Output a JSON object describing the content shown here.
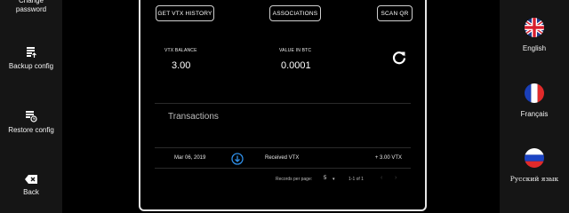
{
  "left_nav": {
    "change_password": "Change password",
    "backup_config": "Backup config",
    "restore_config": "Restore config",
    "back": "Back"
  },
  "languages": [
    {
      "label": "English",
      "flag": "uk-flag-icon"
    },
    {
      "label": "Français",
      "flag": "france-flag-icon"
    },
    {
      "label": "Русский язык",
      "flag": "russia-flag-icon"
    }
  ],
  "toolbar": {
    "vtx_history": "GET VTX HISTORY",
    "associations": "ASSOCIATIONS",
    "scan_qr": "SCAN QR"
  },
  "balances": {
    "vtx_label": "VTX BALANCE",
    "vtx_value": "3.00",
    "btc_label": "VALUE IN BTC",
    "btc_value": "0.0001"
  },
  "transactions": {
    "title": "Transactions",
    "rows": [
      {
        "date": "Mar 06, 2019",
        "description": "Received VTX",
        "amount": "+ 3.00 VTX"
      }
    ]
  },
  "pagination": {
    "records_label": "Records per page:",
    "records_value": "5",
    "range": "1-1 of 1"
  },
  "colors": {
    "background": "#000000",
    "sidebar": "#151515",
    "accent_blue": "#2f8fe8",
    "panel_border": "#e6e6e6"
  }
}
